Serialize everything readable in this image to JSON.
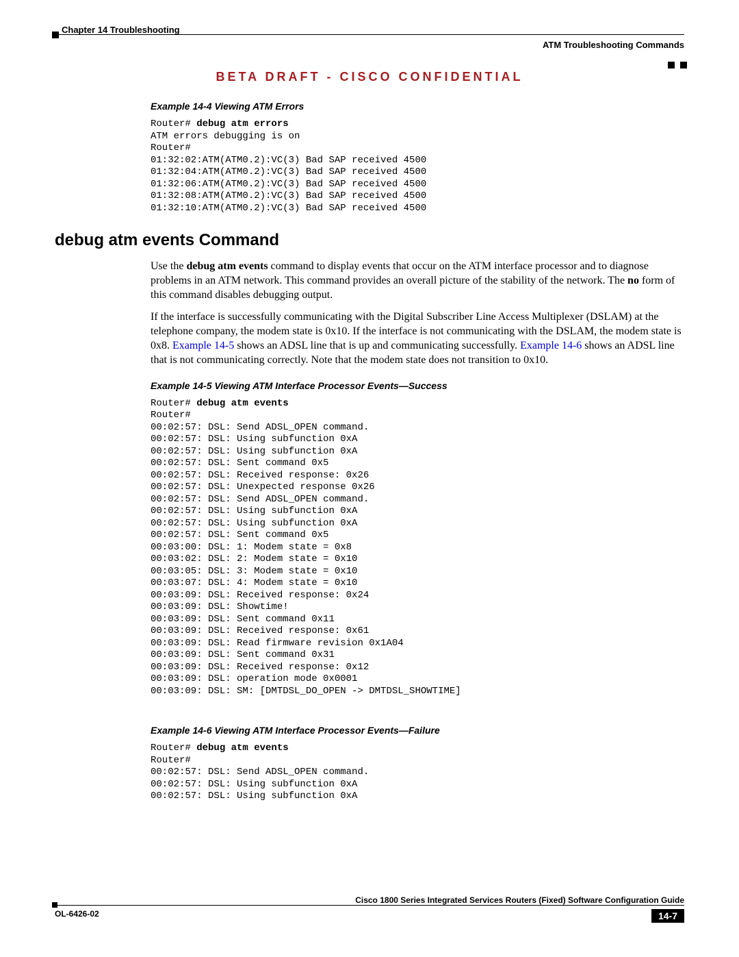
{
  "header": {
    "chapter": "Chapter 14    Troubleshooting",
    "section_right": "ATM Troubleshooting Commands"
  },
  "banner": "BETA DRAFT - CISCO CONFIDENTIAL",
  "example4": {
    "title": "Example 14-4   Viewing ATM Errors",
    "prompt": "Router# ",
    "command": "debug atm errors",
    "output": "ATM errors debugging is on\nRouter#\n01:32:02:ATM(ATM0.2):VC(3) Bad SAP received 4500\n01:32:04:ATM(ATM0.2):VC(3) Bad SAP received 4500\n01:32:06:ATM(ATM0.2):VC(3) Bad SAP received 4500\n01:32:08:ATM(ATM0.2):VC(3) Bad SAP received 4500\n01:32:10:ATM(ATM0.2):VC(3) Bad SAP received 4500"
  },
  "section_heading": "debug atm events Command",
  "para1": {
    "a": "Use the ",
    "b": "debug atm events",
    "c": " command to display events that occur on the ATM interface processor and to diagnose problems in an ATM network. This command provides an overall picture of the stability of the network. The ",
    "d": "no",
    "e": " form of this command disables debugging output."
  },
  "para2": {
    "a": "If the interface is successfully communicating with the Digital Subscriber Line Access Multiplexer (DSLAM) at the telephone company, the modem state is 0x10. If the interface is not communicating with the DSLAM, the modem state is 0x8. ",
    "link1": "Example 14-5",
    "b": " shows an ADSL line that is up and communicating successfully. ",
    "link2": "Example 14-6",
    "c": " shows an ADSL line that is not communicating correctly. Note that the modem state does not transition to 0x10."
  },
  "example5": {
    "title": "Example 14-5   Viewing ATM Interface Processor Events—Success",
    "prompt": "Router# ",
    "command": "debug atm events",
    "output": "Router#\n00:02:57: DSL: Send ADSL_OPEN command.\n00:02:57: DSL: Using subfunction 0xA\n00:02:57: DSL: Using subfunction 0xA\n00:02:57: DSL: Sent command 0x5\n00:02:57: DSL: Received response: 0x26\n00:02:57: DSL: Unexpected response 0x26\n00:02:57: DSL: Send ADSL_OPEN command.\n00:02:57: DSL: Using subfunction 0xA\n00:02:57: DSL: Using subfunction 0xA\n00:02:57: DSL: Sent command 0x5\n00:03:00: DSL: 1: Modem state = 0x8\n00:03:02: DSL: 2: Modem state = 0x10\n00:03:05: DSL: 3: Modem state = 0x10\n00:03:07: DSL: 4: Modem state = 0x10\n00:03:09: DSL: Received response: 0x24\n00:03:09: DSL: Showtime!\n00:03:09: DSL: Sent command 0x11\n00:03:09: DSL: Received response: 0x61\n00:03:09: DSL: Read firmware revision 0x1A04\n00:03:09: DSL: Sent command 0x31\n00:03:09: DSL: Received response: 0x12\n00:03:09: DSL: operation mode 0x0001\n00:03:09: DSL: SM: [DMTDSL_DO_OPEN -> DMTDSL_SHOWTIME]"
  },
  "example6": {
    "title": "Example 14-6   Viewing ATM Interface Processor Events—Failure",
    "prompt": "Router# ",
    "command": "debug atm events",
    "output": "Router#\n00:02:57: DSL: Send ADSL_OPEN command.\n00:02:57: DSL: Using subfunction 0xA\n00:02:57: DSL: Using subfunction 0xA"
  },
  "footer": {
    "doc_title": "Cisco 1800 Series Integrated Services Routers (Fixed) Software Configuration Guide",
    "doc_number": "OL-6426-02",
    "page_number": "14-7"
  }
}
